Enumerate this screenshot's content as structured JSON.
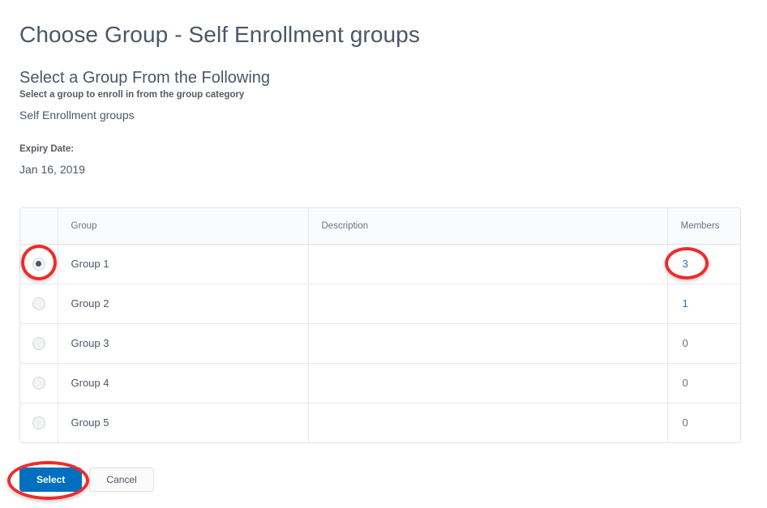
{
  "page": {
    "title": "Choose Group - Self Enrollment groups",
    "section_title": "Select a Group From the Following"
  },
  "fields": {
    "category_label": "Select a group to enroll in from the group category",
    "category_value": "Self Enrollment groups",
    "expiry_label": "Expiry Date:",
    "expiry_value": "Jan 16, 2019"
  },
  "table": {
    "columns": [
      "",
      "Group",
      "Description",
      "Members"
    ],
    "rows": [
      {
        "selected": true,
        "group": "Group 1",
        "description": "",
        "members": "3",
        "members_is_link": true
      },
      {
        "selected": false,
        "group": "Group 2",
        "description": "",
        "members": "1",
        "members_is_link": true
      },
      {
        "selected": false,
        "group": "Group 3",
        "description": "",
        "members": "0",
        "members_is_link": false
      },
      {
        "selected": false,
        "group": "Group 4",
        "description": "",
        "members": "0",
        "members_is_link": false
      },
      {
        "selected": false,
        "group": "Group 5",
        "description": "",
        "members": "0",
        "members_is_link": false
      }
    ]
  },
  "buttons": {
    "select_label": "Select",
    "cancel_label": "Cancel"
  },
  "annotations": {
    "color": "#ee2b2b",
    "targets": [
      "selected-radio",
      "members-count-3",
      "select-button"
    ]
  },
  "colors": {
    "primary_button": "#006fbf",
    "link": "#1f6fc4",
    "text": "#4a5766",
    "table_border": "#dfe3e8",
    "header_bg": "#fafbfc"
  }
}
